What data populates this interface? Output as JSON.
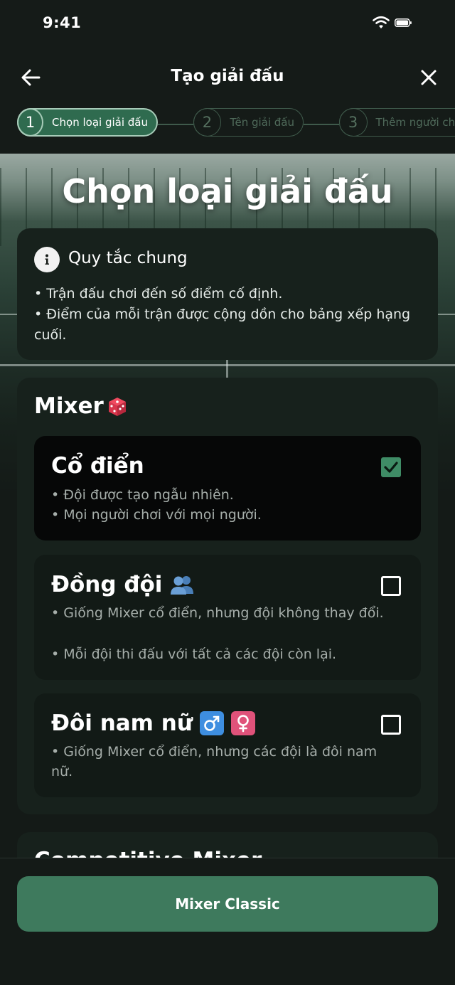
{
  "status_bar": {
    "time": "9:41"
  },
  "header": {
    "title": "Tạo giải đấu"
  },
  "stepper": {
    "steps": [
      {
        "number": "1",
        "label": "Chọn loại giải đấu"
      },
      {
        "number": "2",
        "label": "Tên giải đấu"
      },
      {
        "number": "3",
        "label": "Thêm người chơi"
      }
    ]
  },
  "hero": {
    "title": "Chọn loại giải đấu"
  },
  "rules": {
    "title": "Quy tắc chung",
    "lines": [
      "• Trận đấu chơi đến số điểm cố định.",
      "• Điểm của mỗi trận được cộng dồn cho bảng xếp hạng cuối."
    ]
  },
  "mixer": {
    "title": "Mixer",
    "options": [
      {
        "title": "Cổ điển",
        "desc": [
          "• Đội được tạo ngẫu nhiên.",
          "• Mọi người chơi với mọi người."
        ],
        "checked": true
      },
      {
        "title": "Đồng đội",
        "desc": [
          "• Giống Mixer cổ điển, nhưng đội không thay đổi.",
          "• Mỗi đội thi đấu với tất cả các đội còn lại."
        ],
        "checked": false
      },
      {
        "title": "Đôi nam nữ",
        "desc": [
          "• Giống Mixer cổ điển, nhưng các đội là đôi nam nữ."
        ],
        "checked": false
      }
    ]
  },
  "next_section": {
    "title": "Competitive Mixer"
  },
  "footer": {
    "button_label": "Mixer Classic"
  },
  "colors": {
    "accent": "#3e7a5d",
    "background": "#141a17",
    "card": "#17211c"
  }
}
